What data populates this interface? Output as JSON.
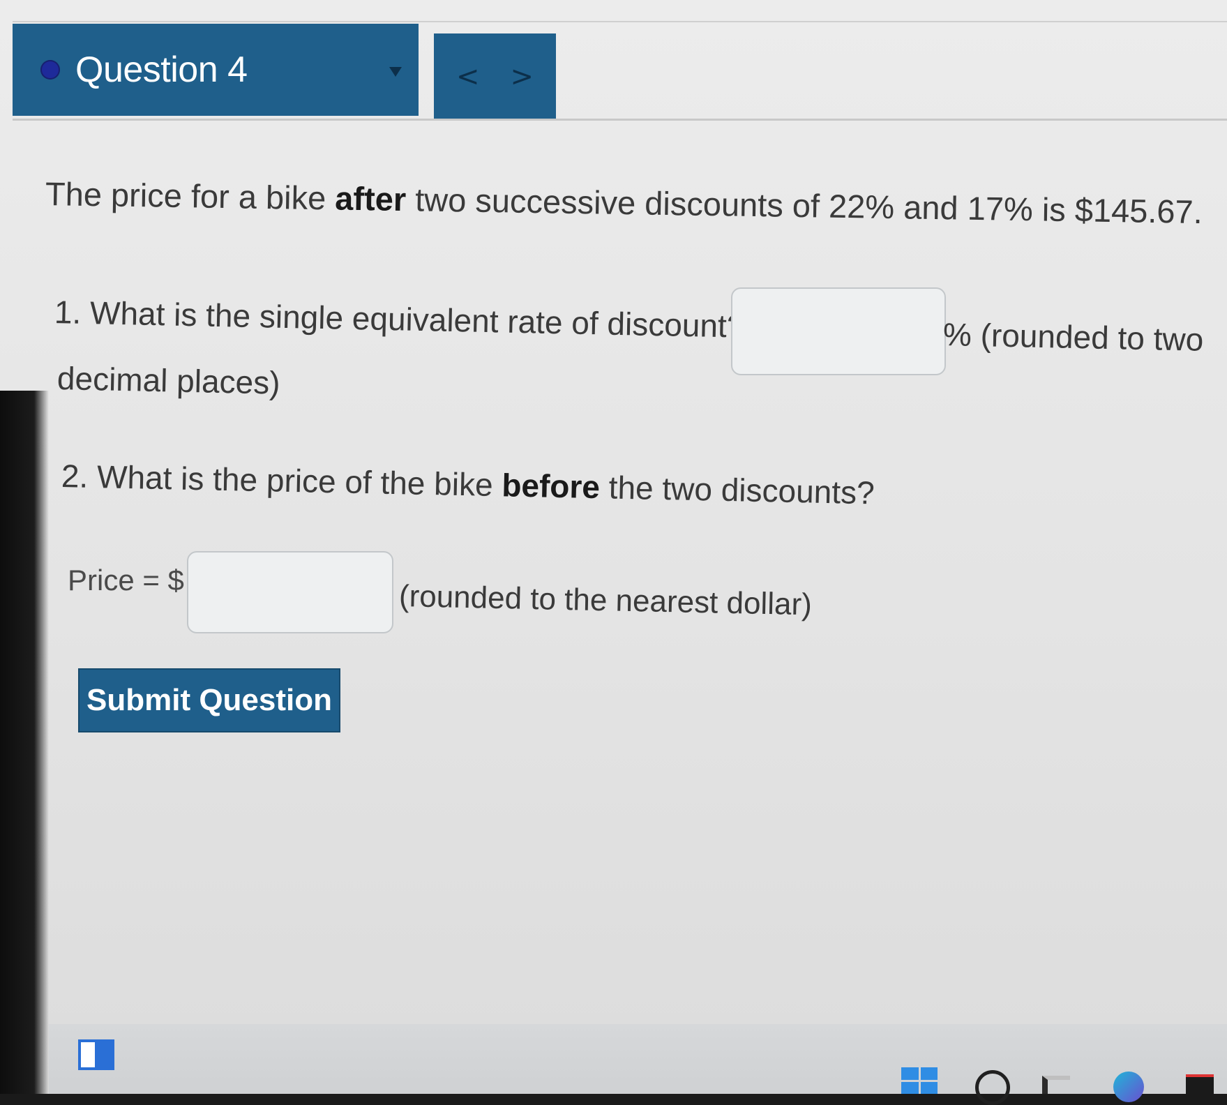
{
  "header": {
    "question_title": "Question 4",
    "status_dot_color": "#1e2a9a",
    "prev_label": "<",
    "next_label": ">",
    "accent_color": "#1f5f8b"
  },
  "problem": {
    "intro_pre": "The price for a bike ",
    "intro_bold": "after",
    "intro_post": " two successive discounts of 22% and 17% is $145.67.",
    "q1_text": "1. What is the single equivalent rate of discount?",
    "q1_input_value": "",
    "q1_suffix": "% (rounded to two",
    "q1_cont": "decimal places)",
    "q2_pre": "2. What is the price of the bike ",
    "q2_bold": "before",
    "q2_post": " the two discounts?",
    "price_label": "Price = $",
    "price_input_value": "",
    "price_suffix": "(rounded to the nearest dollar)"
  },
  "actions": {
    "submit_label": "Submit Question"
  },
  "taskbar": {
    "icons": [
      "app-icon",
      "windows-start-icon",
      "search-icon",
      "task-view-icon",
      "edge-browser-icon",
      "store-icon"
    ]
  }
}
